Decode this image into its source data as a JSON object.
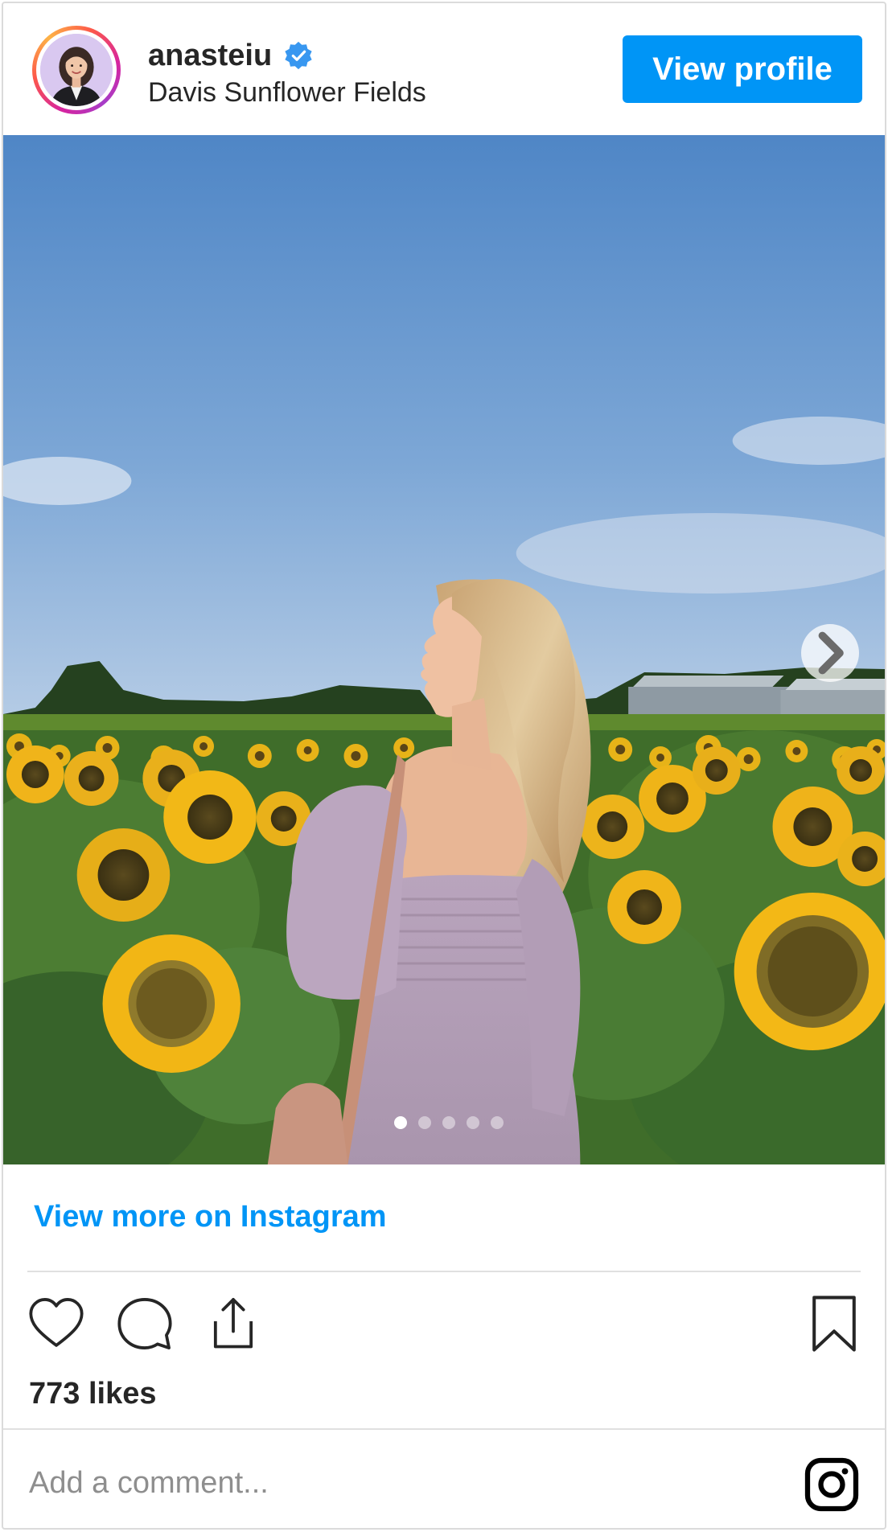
{
  "header": {
    "username": "anasteiu",
    "verified": true,
    "location": "Davis Sunflower Fields",
    "view_profile_label": "View profile"
  },
  "post": {
    "carousel": {
      "total_slides": 5,
      "active_slide": 1
    }
  },
  "footer": {
    "view_more_label": "View more on Instagram",
    "likes_text": "773 likes",
    "comment_placeholder": "Add a comment..."
  },
  "colors": {
    "accent": "#0095f6",
    "text": "#262626",
    "muted": "#8e8e8e",
    "divider": "#e0e0e0"
  },
  "icons": [
    "verified-badge-icon",
    "next-arrow-icon",
    "heart-icon",
    "comment-icon",
    "share-icon",
    "bookmark-icon",
    "instagram-logo-icon"
  ]
}
